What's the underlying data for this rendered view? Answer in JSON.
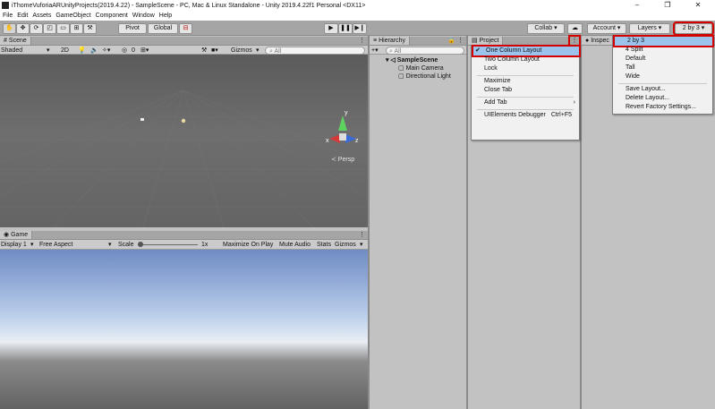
{
  "window": {
    "title": "iThomeVuforiaARUnityProjects(2019.4.22) - SampleScene - PC, Mac & Linux Standalone - Unity 2019.4.22f1 Personal <DX11>",
    "controls": [
      "–",
      "❐",
      "✕"
    ]
  },
  "menubar": [
    "File",
    "Edit",
    "Assets",
    "GameObject",
    "Component",
    "Window",
    "Help"
  ],
  "toolbar": {
    "pivot": "Pivot",
    "global": "Global",
    "collab": "Collab ▾",
    "account": "Account",
    "layers": "Layers",
    "layout": "2 by 3"
  },
  "scene": {
    "tab": "Scene",
    "shading": "Shaded",
    "mode_2d": "2D",
    "fx_count": "0",
    "gizmos": "Gizmos",
    "search_placeholder": "All",
    "persp": "≺ Persp",
    "axis_x": "x",
    "axis_z": "z",
    "axis_y": "y"
  },
  "game": {
    "tab": "Game",
    "display": "Display 1",
    "aspect": "Free Aspect",
    "scale_label": "Scale",
    "scale_value": "1x",
    "toggles": [
      "Maximize On Play",
      "Mute Audio",
      "Stats",
      "Gizmos"
    ]
  },
  "hierarchy": {
    "tab": "Hierarchy",
    "add": "+▾",
    "search_placeholder": "All",
    "scene": "SampleScene",
    "items": [
      "Main Camera",
      "Directional Light"
    ]
  },
  "project": {
    "tab": "Project"
  },
  "inspector": {
    "tab": "Inspec"
  },
  "project_menu": {
    "items": [
      {
        "label": "One Column Layout",
        "checked": true
      },
      {
        "label": "Two Column Layout"
      },
      {
        "label": "Lock"
      },
      {
        "label": "Maximize"
      },
      {
        "label": "Close Tab"
      },
      {
        "label": "Add Tab",
        "submenu": true
      },
      {
        "label": "UIElements Debugger",
        "shortcut": "Ctrl+F5"
      }
    ]
  },
  "layout_menu": {
    "items": [
      "2 by 3",
      "4 Split",
      "Default",
      "Tall",
      "Wide",
      "Save Layout...",
      "Delete Layout...",
      "Revert Factory Settings..."
    ]
  },
  "colors": {
    "highlight": "#d40000",
    "selection": "#9cc3ec"
  }
}
